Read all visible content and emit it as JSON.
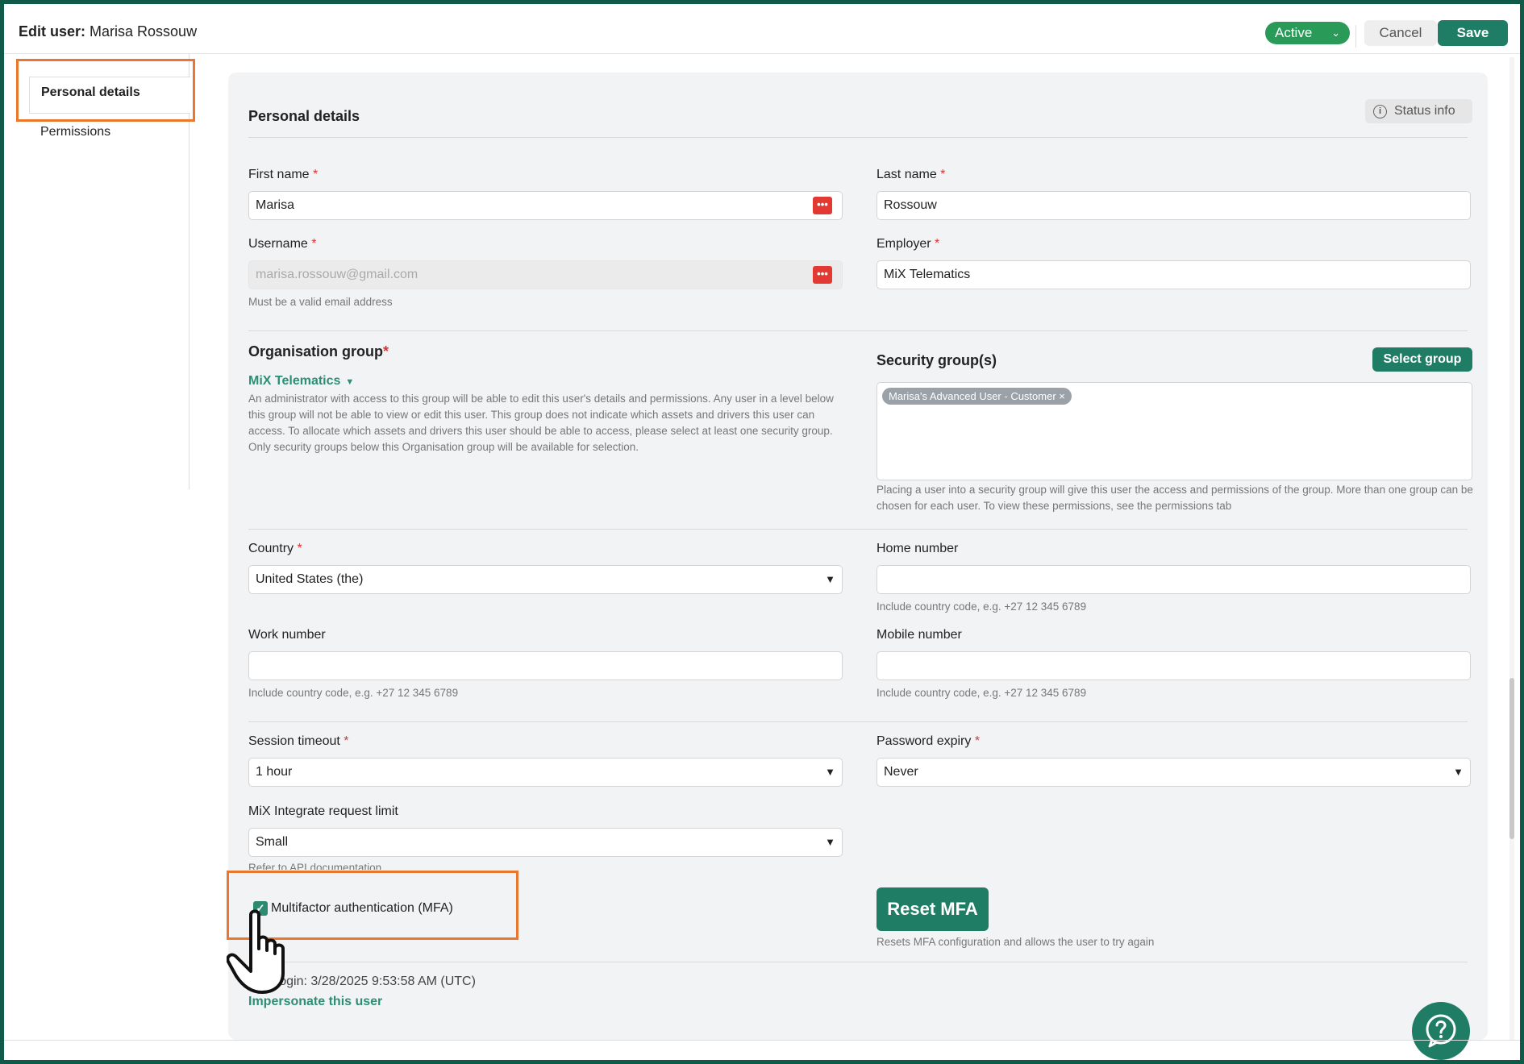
{
  "header": {
    "title_prefix": "Edit user:",
    "title_name": "Marisa Rossouw",
    "status": "Active",
    "cancel_label": "Cancel",
    "save_label": "Save"
  },
  "sidebar": {
    "items": [
      {
        "label": "Personal details",
        "active": true
      },
      {
        "label": "Permissions",
        "active": false
      }
    ]
  },
  "main": {
    "section_title": "Personal details",
    "status_info_label": "Status info",
    "first_name": {
      "label": "First name",
      "required": "*",
      "value": "Marisa"
    },
    "last_name": {
      "label": "Last name",
      "required": "*",
      "value": "Rossouw"
    },
    "username": {
      "label": "Username",
      "required": "*",
      "value": "marisa.rossouw@gmail.com",
      "help": "Must be a valid email address"
    },
    "employer": {
      "label": "Employer",
      "required": "*",
      "value": "MiX Telematics"
    },
    "org_group": {
      "label": "Organisation group",
      "required": "*",
      "value": "MiX Telematics",
      "help": "An administrator with access to this group will be able to edit this user's details and permissions. Any user in a level below this group will not be able to view or edit this user. This group does not indicate which assets and drivers this user can access. To allocate which assets and drivers this user should be able to access, please select at least one security group. Only security groups below this Organisation group will be available for selection."
    },
    "security_groups": {
      "label": "Security group(s)",
      "select_button": "Select group",
      "tags": [
        "Marisa's Advanced User - Customer"
      ],
      "help": "Placing a user into a security group will give this user the access and permissions of the group. More than one group can be chosen for each user. To view these permissions, see the permissions tab"
    },
    "country": {
      "label": "Country",
      "required": "*",
      "value": "United States (the)"
    },
    "home_number": {
      "label": "Home number",
      "value": "",
      "help": "Include country code, e.g. +27 12 345 6789"
    },
    "work_number": {
      "label": "Work number",
      "value": "",
      "help": "Include country code, e.g. +27 12 345 6789"
    },
    "mobile_number": {
      "label": "Mobile number",
      "value": "",
      "help": "Include country code, e.g. +27 12 345 6789"
    },
    "session_timeout": {
      "label": "Session timeout",
      "required": "*",
      "value": "1 hour"
    },
    "password_expiry": {
      "label": "Password expiry",
      "required": "*",
      "value": "Never"
    },
    "request_limit": {
      "label": "MiX Integrate request limit",
      "value": "Small",
      "help": "Refer to API documentation"
    },
    "mfa": {
      "label": "Multifactor authentication (MFA)",
      "checked": true
    },
    "reset_mfa": {
      "label": "Reset MFA",
      "help": "Resets MFA configuration and allows the user to try again"
    },
    "last_login": "Last login: 3/28/2025 9:53:58 AM (UTC)",
    "impersonate_label": "Impersonate this user"
  },
  "colors": {
    "accent": "#1f7d65",
    "status": "#2a9a59",
    "highlight": "#e9782e",
    "required": "#dd3333"
  }
}
